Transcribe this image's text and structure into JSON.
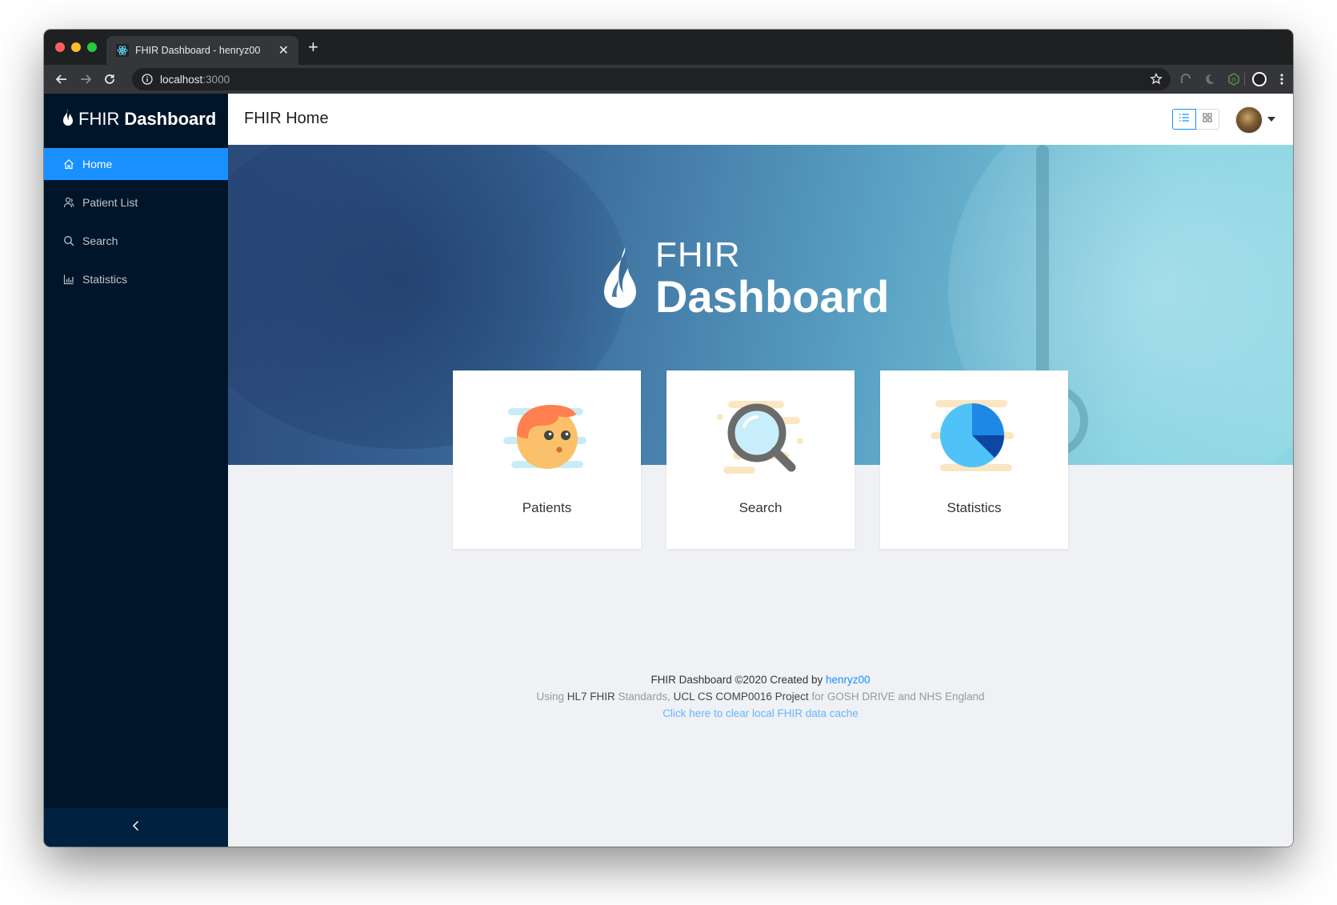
{
  "browser": {
    "tab_title": "FHIR Dashboard - henryz00",
    "url_host": "localhost",
    "url_port": ":3000"
  },
  "sidebar": {
    "logo_fhir": "FHIR",
    "logo_dashboard": "Dashboard",
    "items": [
      {
        "label": "Home",
        "icon": "home-icon",
        "active": true
      },
      {
        "label": "Patient List",
        "icon": "users-icon",
        "active": false
      },
      {
        "label": "Search",
        "icon": "search-icon",
        "active": false
      },
      {
        "label": "Statistics",
        "icon": "bar-chart-icon",
        "active": false
      }
    ],
    "collapse_glyph": "‹"
  },
  "header": {
    "title": "FHIR Home"
  },
  "hero": {
    "logo_line1": "FHIR",
    "logo_line2": "Dashboard"
  },
  "cards": [
    {
      "label": "Patients",
      "icon": "patient-face-icon"
    },
    {
      "label": "Search",
      "icon": "magnifier-icon"
    },
    {
      "label": "Statistics",
      "icon": "pie-chart-icon"
    }
  ],
  "footer": {
    "line1_prefix": "FHIR Dashboard ©2020 Created by ",
    "author": "henryz00",
    "line2_a": "Using ",
    "line2_b": "HL7 FHIR",
    "line2_c": " Standards, ",
    "line2_d": "UCL CS COMP0016 Project",
    "line2_e": " for GOSH DRIVE and NHS England",
    "line3": "Click here to clear local FHIR data cache"
  },
  "colors": {
    "primary": "#1890ff",
    "sider_bg": "#001529",
    "page_bg": "#eff1f5"
  }
}
